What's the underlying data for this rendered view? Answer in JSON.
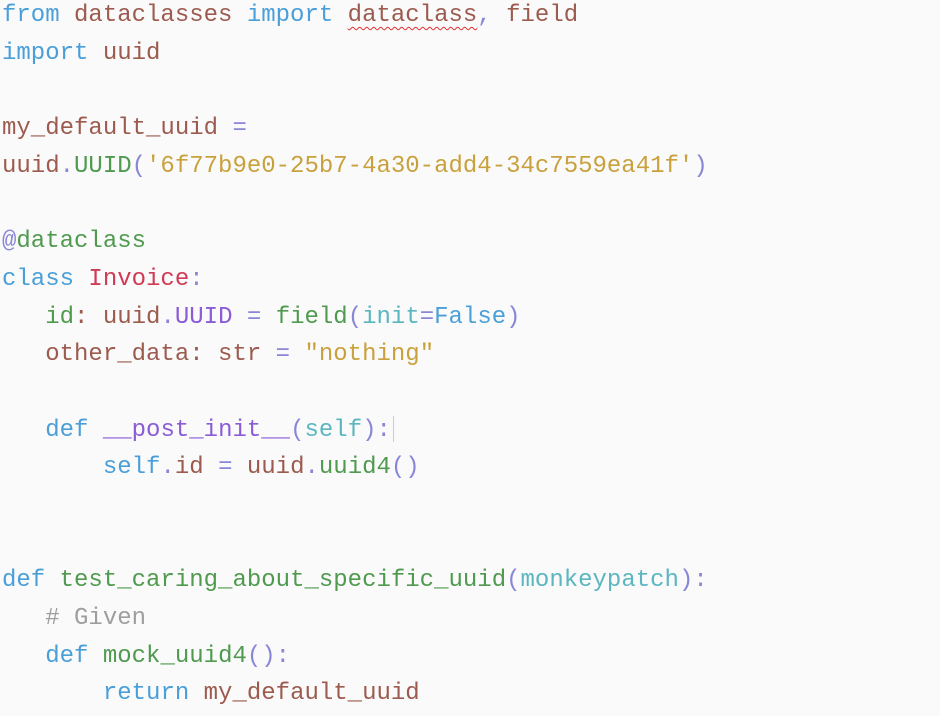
{
  "editor": {
    "language": "python",
    "lines": [
      {
        "tokens": [
          [
            "kw",
            "from"
          ],
          [
            "id",
            " dataclasses "
          ],
          [
            "kw",
            "import"
          ],
          [
            "id",
            " "
          ],
          [
            "sq",
            "dataclass"
          ],
          [
            "pun",
            ","
          ],
          [
            "id",
            " field"
          ]
        ]
      },
      {
        "tokens": [
          [
            "kw",
            "import"
          ],
          [
            "id",
            " uuid"
          ]
        ]
      },
      {
        "tokens": []
      },
      {
        "tokens": [
          [
            "id",
            "my_default_uuid "
          ],
          [
            "pun",
            "="
          ]
        ]
      },
      {
        "tokens": [
          [
            "id",
            "uuid"
          ],
          [
            "pun",
            "."
          ],
          [
            "fn",
            "UUID"
          ],
          [
            "pun",
            "("
          ],
          [
            "str",
            "'6f77b9e0-25b7-4a30-add4-34c7559ea41f'"
          ],
          [
            "pun",
            ")"
          ]
        ]
      },
      {
        "tokens": []
      },
      {
        "tokens": [
          [
            "pun",
            "@"
          ],
          [
            "fn",
            "dataclass"
          ]
        ]
      },
      {
        "tokens": [
          [
            "kw",
            "class"
          ],
          [
            "id",
            " "
          ],
          [
            "cls",
            "Invoice"
          ],
          [
            "pun",
            ":"
          ]
        ]
      },
      {
        "tokens": [
          [
            "id",
            "   "
          ],
          [
            "fn",
            "id"
          ],
          [
            "id",
            ": uuid"
          ],
          [
            "pun",
            "."
          ],
          [
            "mag",
            "UUID"
          ],
          [
            "id",
            " "
          ],
          [
            "pun",
            "="
          ],
          [
            "id",
            " "
          ],
          [
            "fn",
            "field"
          ],
          [
            "pun",
            "("
          ],
          [
            "par",
            "init"
          ],
          [
            "pun",
            "="
          ],
          [
            "kw",
            "False"
          ],
          [
            "pun",
            ")"
          ]
        ]
      },
      {
        "tokens": [
          [
            "id",
            "   other_data: str "
          ],
          [
            "pun",
            "="
          ],
          [
            "id",
            " "
          ],
          [
            "str",
            "\"nothing\""
          ]
        ]
      },
      {
        "tokens": []
      },
      {
        "tokens": [
          [
            "id",
            "   "
          ],
          [
            "kw",
            "def"
          ],
          [
            "id",
            " "
          ],
          [
            "mag",
            "__post_init__"
          ],
          [
            "pun",
            "("
          ],
          [
            "par",
            "self"
          ],
          [
            "pun",
            "):"
          ],
          [
            "caret",
            ""
          ]
        ]
      },
      {
        "tokens": [
          [
            "id",
            "       "
          ],
          [
            "kw",
            "self"
          ],
          [
            "pun",
            "."
          ],
          [
            "id",
            "id "
          ],
          [
            "pun",
            "="
          ],
          [
            "id",
            " uuid"
          ],
          [
            "pun",
            "."
          ],
          [
            "fn",
            "uuid4"
          ],
          [
            "pun",
            "()"
          ]
        ]
      },
      {
        "tokens": []
      },
      {
        "tokens": []
      },
      {
        "tokens": [
          [
            "kw",
            "def"
          ],
          [
            "id",
            " "
          ],
          [
            "fn",
            "test_caring_about_specific_uuid"
          ],
          [
            "pun",
            "("
          ],
          [
            "par",
            "monkeypatch"
          ],
          [
            "pun",
            "):"
          ]
        ]
      },
      {
        "tokens": [
          [
            "id",
            "   "
          ],
          [
            "cm",
            "# Given"
          ]
        ]
      },
      {
        "tokens": [
          [
            "id",
            "   "
          ],
          [
            "kw",
            "def"
          ],
          [
            "id",
            " "
          ],
          [
            "fn",
            "mock_uuid4"
          ],
          [
            "pun",
            "():"
          ]
        ]
      },
      {
        "tokens": [
          [
            "id",
            "       "
          ],
          [
            "kw",
            "return"
          ],
          [
            "id",
            " my_default_uuid"
          ]
        ]
      }
    ]
  }
}
